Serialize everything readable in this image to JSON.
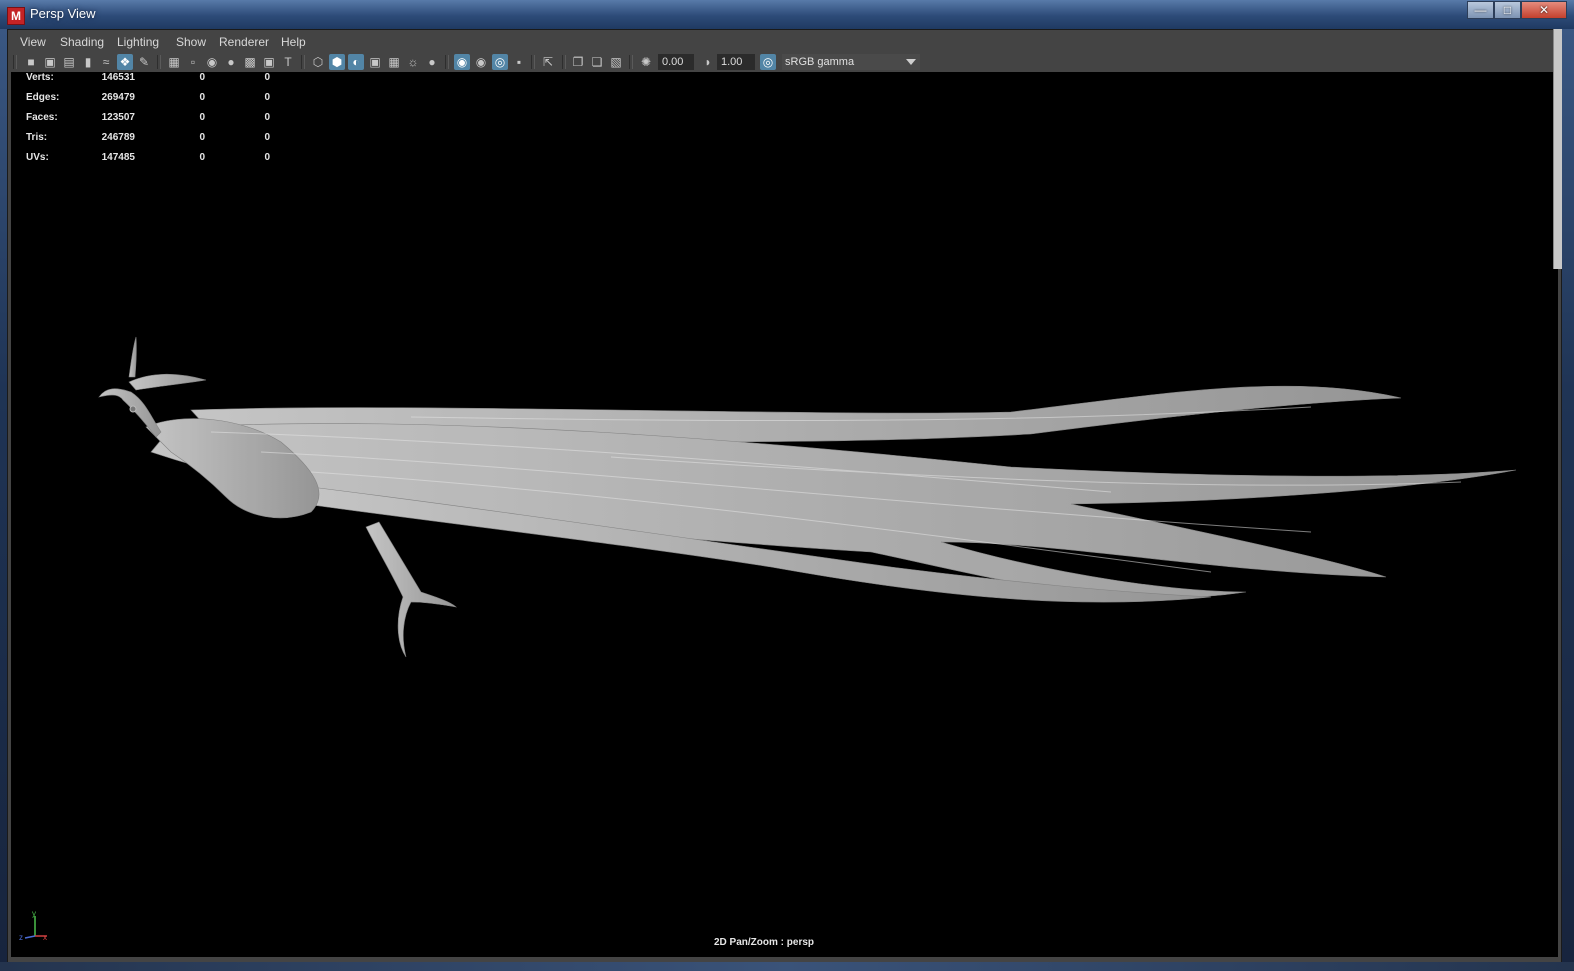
{
  "window": {
    "title": "Persp View",
    "app_icon": "M",
    "controls": [
      "minimize-icon",
      "maximize-icon",
      "close-icon"
    ]
  },
  "menu": [
    "View",
    "Shading",
    "Lighting",
    "Show",
    "Renderer",
    "Help"
  ],
  "toolbar": {
    "exposure_value": "0.00",
    "gamma_value": "1.00",
    "color_management_toggle": "cm-icon",
    "view_transform": "sRGB gamma"
  },
  "hud": {
    "rows": [
      {
        "label": "Verts:",
        "value": "146531",
        "c1": "0",
        "c2": "0"
      },
      {
        "label": "Edges:",
        "value": "269479",
        "c1": "0",
        "c2": "0"
      },
      {
        "label": "Faces:",
        "value": "123507",
        "c1": "0",
        "c2": "0"
      },
      {
        "label": "Tris:",
        "value": "246789",
        "c1": "0",
        "c2": "0"
      },
      {
        "label": "UVs:",
        "value": "147485",
        "c1": "0",
        "c2": "0"
      }
    ]
  },
  "viewport": {
    "camera_label": "2D Pan/Zoom : persp",
    "axis_labels": [
      "y",
      "z",
      "x"
    ],
    "subject": "phoenix model"
  },
  "colors": {
    "panel_bg": "#444444",
    "viewport_bg": "#000000",
    "active_icon": "#5285a6",
    "model": "#b9b9b9"
  }
}
